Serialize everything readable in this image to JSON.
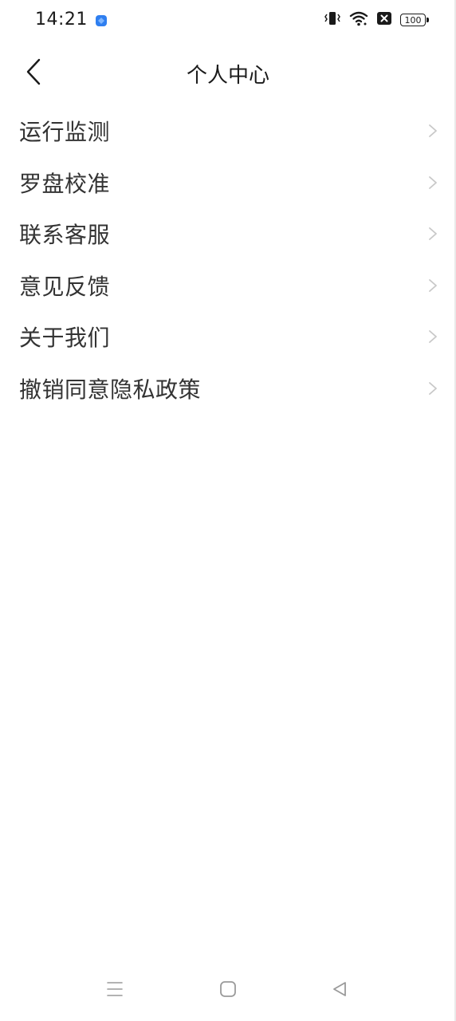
{
  "status_bar": {
    "time": "14:21",
    "battery_level": "100",
    "icons": [
      "app-notification-icon",
      "vibrate-icon",
      "wifi-icon",
      "sim-blocked-icon",
      "battery-icon"
    ]
  },
  "header": {
    "title": "个人中心",
    "back_icon": "chevron-left-icon"
  },
  "menu": {
    "items": [
      {
        "label": "运行监测"
      },
      {
        "label": "罗盘校准"
      },
      {
        "label": "联系客服"
      },
      {
        "label": "意见反馈"
      },
      {
        "label": "关于我们"
      },
      {
        "label": "撤销同意隐私政策"
      }
    ],
    "chevron_icon": "chevron-right-icon"
  },
  "nav_bar": {
    "buttons": [
      "menu-icon",
      "home-icon",
      "back-triangle-icon"
    ]
  },
  "colors": {
    "background": "#ffffff",
    "text_primary": "#333333",
    "title": "#1a1a1a",
    "chevron": "#c8c8c8",
    "nav_icon": "#9a9a9a",
    "app_icon_blue": "#2f7ff0"
  }
}
